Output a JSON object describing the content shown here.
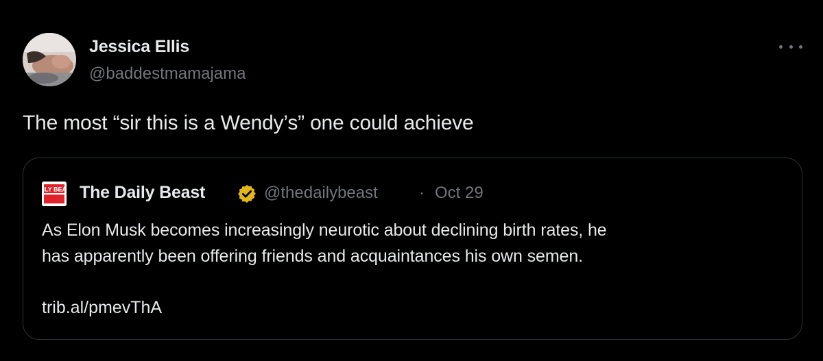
{
  "tweet": {
    "author": {
      "display_name": "Jessica Ellis",
      "handle": "@baddestmamajama",
      "avatar_icon": "profile-photo"
    },
    "more_icon": "more-horizontal-icon",
    "text": "The most “sir this is a Wendy’s” one could achieve"
  },
  "quote": {
    "author": {
      "display_name": "The Daily Beast",
      "handle": "@thedailybeast",
      "separator": "·",
      "date": "Oct 29",
      "logo_icon": "daily-beast-logo",
      "logo_text": "DAILY BEAST",
      "verified_icon": "verified-badge-icon"
    },
    "body_line1": "As Elon Musk becomes increasingly neurotic about declining birth rates, he",
    "body_line2": "has apparently been offering friends and acquaintances his own semen.",
    "link": "trib.al/pmevThA"
  },
  "colors": {
    "background": "#000000",
    "text_primary": "#e7e9ea",
    "text_secondary": "#71767b",
    "border": "#2f3336",
    "verified_gold": "#e2b719",
    "logo_red": "#e0232a"
  }
}
